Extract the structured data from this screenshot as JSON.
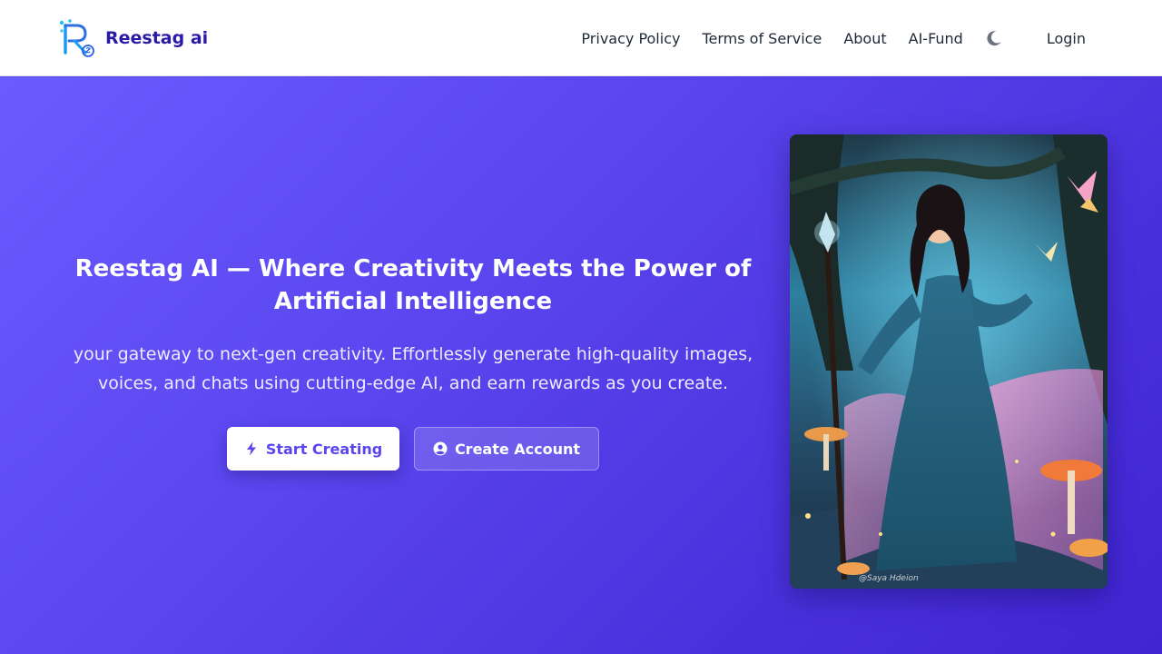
{
  "brand": {
    "name": "Reestag ai",
    "logo_icon": "reestag-r-logo-icon",
    "logo_color": "#1d9bf0"
  },
  "nav": {
    "links": [
      "Privacy Policy",
      "Terms of Service",
      "About",
      "AI-Fund"
    ],
    "theme_toggle_icon": "moon-icon",
    "login_label": "Login"
  },
  "hero": {
    "title": "Reestag AI — Where Creativity Meets the Power of Artificial Intelligence",
    "subtitle": "your gateway to next-gen creativity. Effortlessly generate high-quality images, voices, and chats using cutting-edge AI, and earn rewards as you create.",
    "primary_button": {
      "label": "Start Creating",
      "icon": "bolt-icon"
    },
    "secondary_button": {
      "label": "Create Account",
      "icon": "user-circle-icon"
    },
    "image": {
      "subject": "fantasy-sorceress-illustration",
      "signature": "@Saya Hdeion"
    }
  },
  "colors": {
    "brand_text": "#2a1aa6",
    "hero_gradient_start": "#6a5cff",
    "hero_gradient_end": "#4124d4",
    "primary_button_text": "#5b45ee"
  }
}
